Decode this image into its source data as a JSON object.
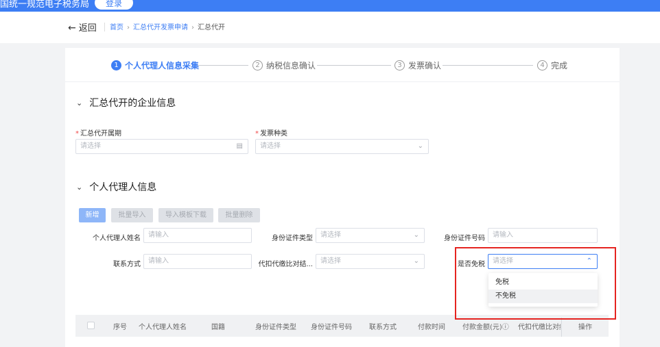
{
  "topbar": {
    "title": "国统一规范电子税务局",
    "login_label": "登录"
  },
  "header": {
    "back_arrow": "←",
    "back_label": "返回",
    "breadcrumb": [
      "首页",
      "汇总代开发票申请",
      "汇总代开"
    ],
    "breadcrumb_sep": "›"
  },
  "steps": [
    {
      "num": "1",
      "label": "个人代理人信息采集",
      "active": true
    },
    {
      "num": "2",
      "label": "纳税信息确认",
      "active": false
    },
    {
      "num": "3",
      "label": "发票确认",
      "active": false
    },
    {
      "num": "4",
      "label": "完成",
      "active": false
    }
  ],
  "section1": {
    "chevron": "⌄",
    "title": "汇总代开的企业信息",
    "required_mark": "*",
    "period_label": "汇总代开属期",
    "period_placeholder": "请选择",
    "period_icon": "▤",
    "invoice_type_label": "发票种类",
    "invoice_type_placeholder": "请选择",
    "select_arrow": "⌄"
  },
  "section2": {
    "chevron": "⌄",
    "title": "个人代理人信息",
    "buttons": [
      "新增",
      "批量导入",
      "导入模板下载",
      "批量删除"
    ],
    "name_label": "个人代理人姓名",
    "name_placeholder": "请输入",
    "id_type_label": "身份证件类型",
    "id_type_placeholder": "请选择",
    "id_number_label": "身份证件号码",
    "id_number_placeholder": "请输入",
    "contact_label": "联系方式",
    "contact_placeholder": "请输入",
    "withhold_label": "代扣代缴比对结...",
    "withhold_placeholder": "请选择",
    "exempt_label": "是否免税",
    "exempt_placeholder": "请选择",
    "select_arrow": "⌄",
    "open_arrow": "⌃",
    "exempt_options": [
      "免税",
      "不免税"
    ]
  },
  "table": {
    "columns": [
      "序号",
      "个人代理人姓名",
      "国籍",
      "身份证件类型",
      "身份证件号码",
      "联系方式",
      "付款时间",
      "付款金额(元)ⓘ",
      "代扣代缴比对结",
      "操作"
    ]
  },
  "colors": {
    "primary": "#3d7ef4",
    "highlight": "#e5231f",
    "required": "#f04848"
  }
}
